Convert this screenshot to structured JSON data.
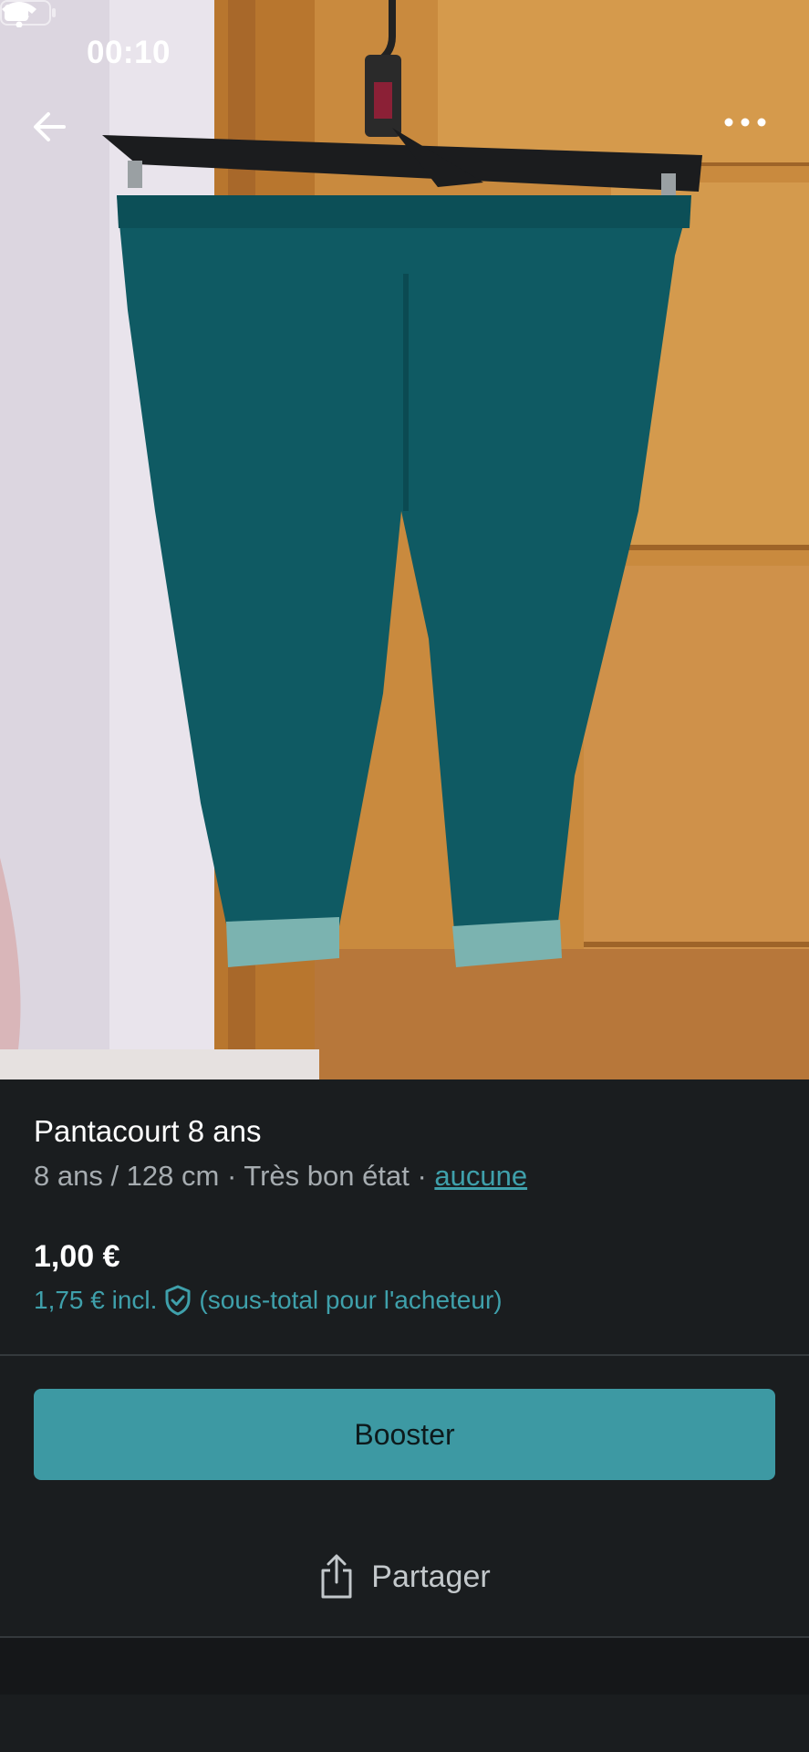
{
  "status_bar": {
    "time": "00:10"
  },
  "nav": {
    "back_icon": "arrow-left-icon",
    "more_icon": "more-dots-icon"
  },
  "listing": {
    "title": "Pantacourt 8 ans",
    "meta_prefix": "8 ans / 128 cm · Très bon état · ",
    "meta_link": "aucune",
    "price": "1,00 €",
    "price_incl": "1,75 € incl.",
    "price_note": "(sous-total pour l'acheteur)"
  },
  "actions": {
    "booster_label": "Booster",
    "share_label": "Partager"
  },
  "colors": {
    "accent": "#3d99a3",
    "link": "#3fa0ab",
    "background": "#1a1d1f"
  }
}
